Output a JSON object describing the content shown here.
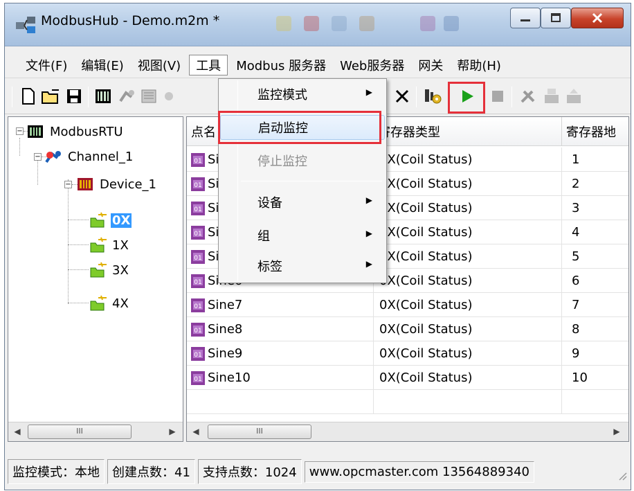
{
  "window": {
    "title": "ModbusHub - Demo.m2m *"
  },
  "menubar": {
    "items": [
      "文件(F)",
      "编辑(E)",
      "视图(V)",
      "工具",
      "Modbus 服务器",
      "Web服务器",
      "网关",
      "帮助(H)"
    ],
    "active_index": 3
  },
  "toolbar": {
    "buttons": [
      "new-icon",
      "open-icon",
      "save-icon",
      "device-icon",
      "channel-icon",
      "group-icon",
      "delete-icon",
      "settings-icon",
      "start-monitor-icon",
      "stop-monitor-icon",
      "tools-icon",
      "load-icon",
      "upload-icon"
    ],
    "highlight_color": "#e5303a",
    "play_color": "#1aa11a"
  },
  "tree": {
    "root": "ModbusRTU",
    "channel": "Channel_1",
    "device": "Device_1",
    "groups": [
      "0X",
      "1X",
      "3X",
      "4X"
    ],
    "selected": "0X"
  },
  "table": {
    "headers": [
      "点名",
      "寄存器类型",
      "寄存器地"
    ],
    "rows": [
      {
        "name": "Sine1",
        "type": "0X(Coil Status)",
        "addr": "1"
      },
      {
        "name": "Sine2",
        "type": "0X(Coil Status)",
        "addr": "2"
      },
      {
        "name": "Sine3",
        "type": "0X(Coil Status)",
        "addr": "3"
      },
      {
        "name": "Sine4",
        "type": "0X(Coil Status)",
        "addr": "4"
      },
      {
        "name": "Sine5",
        "type": "0X(Coil Status)",
        "addr": "5"
      },
      {
        "name": "Sine6",
        "type": "0X(Coil Status)",
        "addr": "6"
      },
      {
        "name": "Sine7",
        "type": "0X(Coil Status)",
        "addr": "7"
      },
      {
        "name": "Sine8",
        "type": "0X(Coil Status)",
        "addr": "8"
      },
      {
        "name": "Sine9",
        "type": "0X(Coil Status)",
        "addr": "9"
      },
      {
        "name": "Sine10",
        "type": "0X(Coil Status)",
        "addr": "10"
      }
    ]
  },
  "dropdown": {
    "items": [
      {
        "label": "监控模式",
        "submenu": true,
        "disabled": false
      },
      {
        "label": "启动监控",
        "submenu": false,
        "disabled": false,
        "highlighted": true
      },
      {
        "label": "停止监控",
        "submenu": false,
        "disabled": true
      },
      {
        "label": "设备",
        "submenu": true,
        "disabled": false
      },
      {
        "label": "组",
        "submenu": true,
        "disabled": false
      },
      {
        "label": "标签",
        "submenu": true,
        "disabled": false
      }
    ]
  },
  "statusbar": {
    "mode": "监控模式：本地",
    "created": "创建点数：41",
    "supported": "支持点数：1024",
    "contact": "www.opcmaster.com 13564889340"
  },
  "scroll_thumb_glyph": "III"
}
